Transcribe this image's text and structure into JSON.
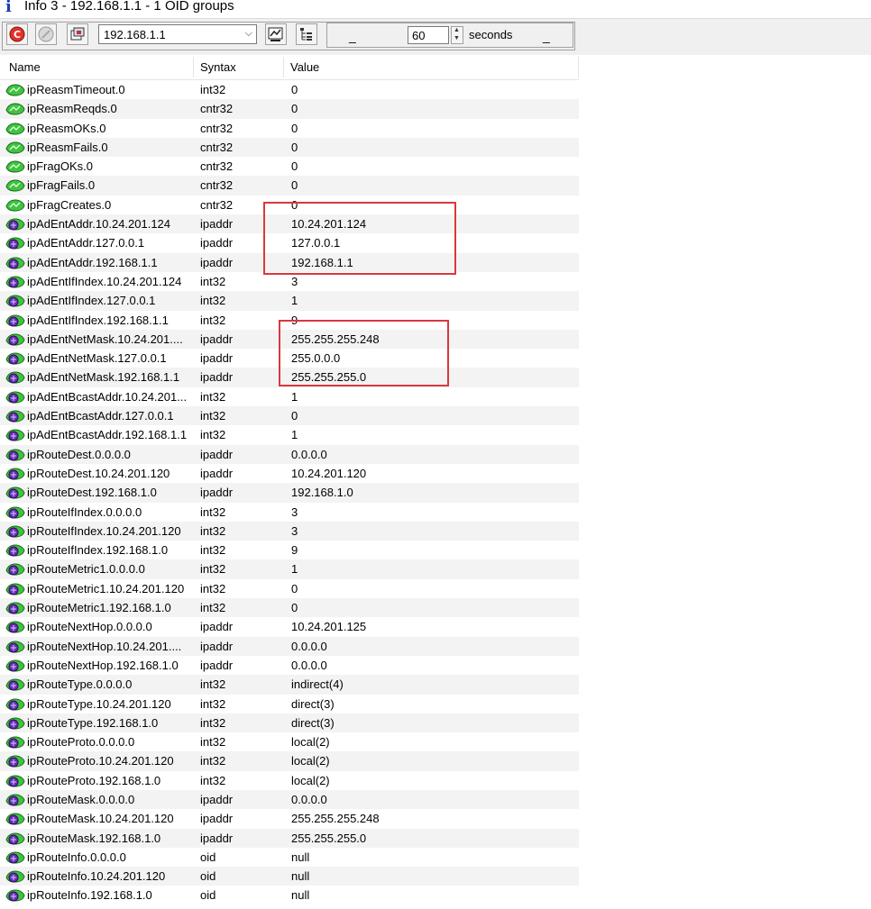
{
  "window": {
    "title": "Info 3  -  192.168.1.1  -  1 OID groups"
  },
  "toolbar": {
    "host_value": "192.168.1.1",
    "interval_value": "60",
    "interval_unit": "seconds",
    "dash_left": "_",
    "dash_right": "_"
  },
  "columns": {
    "name": "Name",
    "syntax": "Syntax",
    "value": "Value"
  },
  "rows": [
    {
      "name": "ipReasmTimeout.0",
      "syntax": "int32",
      "value": "0",
      "icon": "green"
    },
    {
      "name": "ipReasmReqds.0",
      "syntax": "cntr32",
      "value": "0",
      "icon": "green"
    },
    {
      "name": "ipReasmOKs.0",
      "syntax": "cntr32",
      "value": "0",
      "icon": "green"
    },
    {
      "name": "ipReasmFails.0",
      "syntax": "cntr32",
      "value": "0",
      "icon": "green"
    },
    {
      "name": "ipFragOKs.0",
      "syntax": "cntr32",
      "value": "0",
      "icon": "green"
    },
    {
      "name": "ipFragFails.0",
      "syntax": "cntr32",
      "value": "0",
      "icon": "green"
    },
    {
      "name": "ipFragCreates.0",
      "syntax": "cntr32",
      "value": "0",
      "icon": "green"
    },
    {
      "name": "ipAdEntAddr.10.24.201.124",
      "syntax": "ipaddr",
      "value": "10.24.201.124",
      "icon": "purple"
    },
    {
      "name": "ipAdEntAddr.127.0.0.1",
      "syntax": "ipaddr",
      "value": "127.0.0.1",
      "icon": "purple"
    },
    {
      "name": "ipAdEntAddr.192.168.1.1",
      "syntax": "ipaddr",
      "value": "192.168.1.1",
      "icon": "purple"
    },
    {
      "name": "ipAdEntIfIndex.10.24.201.124",
      "syntax": "int32",
      "value": "3",
      "icon": "purple"
    },
    {
      "name": "ipAdEntIfIndex.127.0.0.1",
      "syntax": "int32",
      "value": "1",
      "icon": "purple"
    },
    {
      "name": "ipAdEntIfIndex.192.168.1.1",
      "syntax": "int32",
      "value": "9",
      "icon": "purple"
    },
    {
      "name": "ipAdEntNetMask.10.24.201....",
      "syntax": "ipaddr",
      "value": "255.255.255.248",
      "icon": "purple"
    },
    {
      "name": "ipAdEntNetMask.127.0.0.1",
      "syntax": "ipaddr",
      "value": "255.0.0.0",
      "icon": "purple"
    },
    {
      "name": "ipAdEntNetMask.192.168.1.1",
      "syntax": "ipaddr",
      "value": "255.255.255.0",
      "icon": "purple"
    },
    {
      "name": "ipAdEntBcastAddr.10.24.201...",
      "syntax": "int32",
      "value": "1",
      "icon": "purple"
    },
    {
      "name": "ipAdEntBcastAddr.127.0.0.1",
      "syntax": "int32",
      "value": "0",
      "icon": "purple"
    },
    {
      "name": "ipAdEntBcastAddr.192.168.1.1",
      "syntax": "int32",
      "value": "1",
      "icon": "purple"
    },
    {
      "name": "ipRouteDest.0.0.0.0",
      "syntax": "ipaddr",
      "value": "0.0.0.0",
      "icon": "purple"
    },
    {
      "name": "ipRouteDest.10.24.201.120",
      "syntax": "ipaddr",
      "value": "10.24.201.120",
      "icon": "purple"
    },
    {
      "name": "ipRouteDest.192.168.1.0",
      "syntax": "ipaddr",
      "value": "192.168.1.0",
      "icon": "purple"
    },
    {
      "name": "ipRouteIfIndex.0.0.0.0",
      "syntax": "int32",
      "value": "3",
      "icon": "purple"
    },
    {
      "name": "ipRouteIfIndex.10.24.201.120",
      "syntax": "int32",
      "value": "3",
      "icon": "purple"
    },
    {
      "name": "ipRouteIfIndex.192.168.1.0",
      "syntax": "int32",
      "value": "9",
      "icon": "purple"
    },
    {
      "name": "ipRouteMetric1.0.0.0.0",
      "syntax": "int32",
      "value": "1",
      "icon": "purple"
    },
    {
      "name": "ipRouteMetric1.10.24.201.120",
      "syntax": "int32",
      "value": "0",
      "icon": "purple"
    },
    {
      "name": "ipRouteMetric1.192.168.1.0",
      "syntax": "int32",
      "value": "0",
      "icon": "purple"
    },
    {
      "name": "ipRouteNextHop.0.0.0.0",
      "syntax": "ipaddr",
      "value": "10.24.201.125",
      "icon": "purple"
    },
    {
      "name": "ipRouteNextHop.10.24.201....",
      "syntax": "ipaddr",
      "value": "0.0.0.0",
      "icon": "purple"
    },
    {
      "name": "ipRouteNextHop.192.168.1.0",
      "syntax": "ipaddr",
      "value": "0.0.0.0",
      "icon": "purple"
    },
    {
      "name": "ipRouteType.0.0.0.0",
      "syntax": "int32",
      "value": "indirect(4)",
      "icon": "purple"
    },
    {
      "name": "ipRouteType.10.24.201.120",
      "syntax": "int32",
      "value": "direct(3)",
      "icon": "purple"
    },
    {
      "name": "ipRouteType.192.168.1.0",
      "syntax": "int32",
      "value": "direct(3)",
      "icon": "purple"
    },
    {
      "name": "ipRouteProto.0.0.0.0",
      "syntax": "int32",
      "value": "local(2)",
      "icon": "purple"
    },
    {
      "name": "ipRouteProto.10.24.201.120",
      "syntax": "int32",
      "value": "local(2)",
      "icon": "purple"
    },
    {
      "name": "ipRouteProto.192.168.1.0",
      "syntax": "int32",
      "value": "local(2)",
      "icon": "purple"
    },
    {
      "name": "ipRouteMask.0.0.0.0",
      "syntax": "ipaddr",
      "value": "0.0.0.0",
      "icon": "purple"
    },
    {
      "name": "ipRouteMask.10.24.201.120",
      "syntax": "ipaddr",
      "value": "255.255.255.248",
      "icon": "purple"
    },
    {
      "name": "ipRouteMask.192.168.1.0",
      "syntax": "ipaddr",
      "value": "255.255.255.0",
      "icon": "purple"
    },
    {
      "name": "ipRouteInfo.0.0.0.0",
      "syntax": "oid",
      "value": "null",
      "icon": "purple"
    },
    {
      "name": "ipRouteInfo.10.24.201.120",
      "syntax": "oid",
      "value": "null",
      "icon": "purple"
    },
    {
      "name": "ipRouteInfo.192.168.1.0",
      "syntax": "oid",
      "value": "null",
      "icon": "purple"
    }
  ],
  "highlight_color": "#d9383c",
  "row_alt_color": "#f3f3f3"
}
